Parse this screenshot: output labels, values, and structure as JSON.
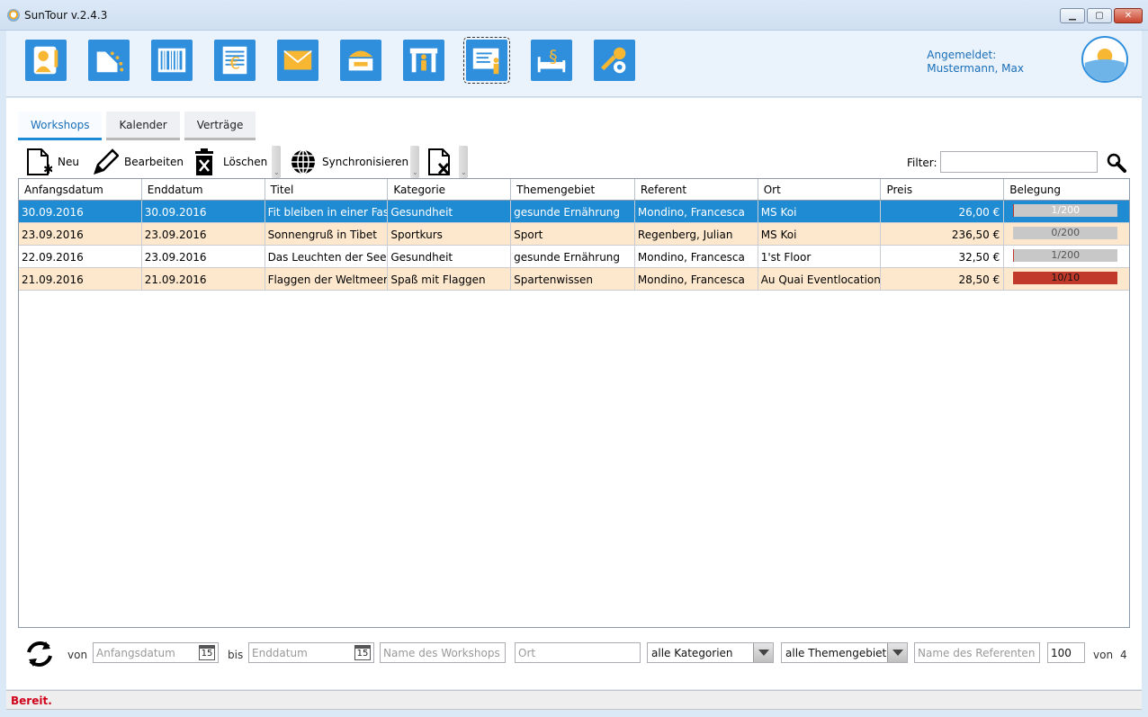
{
  "window": {
    "title": "SunTour v.2.4.3"
  },
  "modules": [
    {
      "icon": "customer-icon"
    },
    {
      "icon": "travel-icon"
    },
    {
      "icon": "barcode-icon"
    },
    {
      "icon": "invoice-icon"
    },
    {
      "icon": "mail-icon"
    },
    {
      "icon": "hotel-icon"
    },
    {
      "icon": "excursion-icon"
    },
    {
      "icon": "workshop-icon"
    },
    {
      "icon": "law-icon"
    },
    {
      "icon": "settings-icon"
    }
  ],
  "login": {
    "label": "Angemeldet:",
    "user": "Mustermann, Max"
  },
  "tabs": [
    {
      "label": "Workshops"
    },
    {
      "label": "Kalender"
    },
    {
      "label": "Verträge"
    }
  ],
  "actions": {
    "new": "Neu",
    "edit": "Bearbeiten",
    "delete": "Löschen",
    "sync": "Synchronisieren",
    "filter_label": "Filter:",
    "filter_value": ""
  },
  "table": {
    "columns": [
      "Anfangsdatum",
      "Enddatum",
      "Titel",
      "Kategorie",
      "Themengebiet",
      "Referent",
      "Ort",
      "Preis",
      "Belegung"
    ],
    "rows": [
      {
        "start": "30.09.2016",
        "end": "30.09.2016",
        "title": "Fit bleiben in einer Fastfood",
        "category": "Gesundheit",
        "topic": "gesunde Ernährung",
        "speaker": "Mondino, Francesca",
        "place": "MS Koi",
        "price": "26,00 €",
        "occupancy": "1/200",
        "fill": 0.005
      },
      {
        "start": "23.09.2016",
        "end": "23.09.2016",
        "title": "Sonnengruß in Tibet",
        "category": "Sportkurs",
        "topic": "Sport",
        "speaker": "Regenberg, Julian",
        "place": "MS Koi",
        "price": "236,50 €",
        "occupancy": "0/200",
        "fill": 0
      },
      {
        "start": "22.09.2016",
        "end": "23.09.2016",
        "title": "Das Leuchten der See",
        "category": "Gesundheit",
        "topic": "gesunde Ernährung",
        "speaker": "Mondino, Francesca",
        "place": "1'st Floor",
        "price": "32,50 €",
        "occupancy": "1/200",
        "fill": 0.005
      },
      {
        "start": "21.09.2016",
        "end": "21.09.2016",
        "title": "Flaggen der Weltmeere",
        "category": "Spaß mit Flaggen",
        "topic": "Spartenwissen",
        "speaker": "Mondino, Francesca",
        "place": "Au Quai Eventlocation",
        "price": "28,50 €",
        "occupancy": "10/10",
        "fill": 1
      }
    ]
  },
  "bottom": {
    "from_label": "von",
    "to_label": "bis",
    "start_placeholder": "Anfangsdatum",
    "end_placeholder": "Enddatum",
    "name_placeholder": "Name des Workshops",
    "place_placeholder": "Ort",
    "category_value": "alle Kategorien",
    "topic_value": "alle Themengebiete",
    "speaker_placeholder": "Name des Referenten",
    "page_size": "100",
    "of_label": "von",
    "total": "4",
    "calendar_day": "15"
  },
  "status": {
    "text": "Bereit."
  }
}
